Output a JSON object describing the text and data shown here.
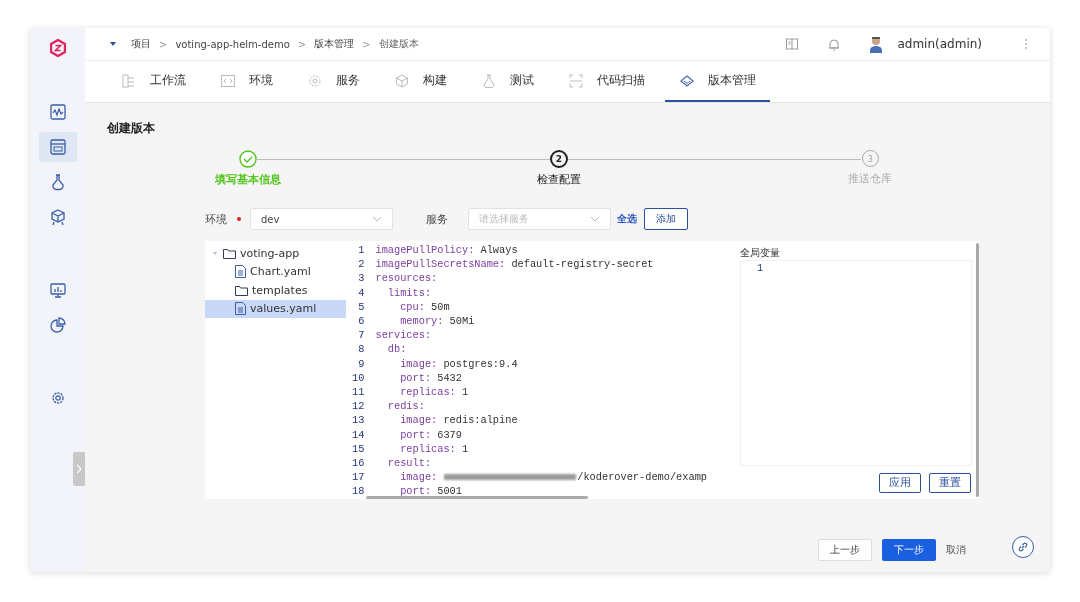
{
  "breadcrumb": [
    {
      "label": "项目"
    },
    {
      "separator": ">",
      "label": "voting-app-helm-demo"
    },
    {
      "separator": ">",
      "label": "版本管理"
    },
    {
      "separator": ">",
      "label": "创建版本"
    }
  ],
  "user": {
    "name": "admin(admin)"
  },
  "sidebar": {
    "items": [
      {
        "selected": false
      },
      {
        "selected": true
      },
      {
        "selected": false
      },
      {
        "selected": false
      },
      {
        "selected": false
      },
      {
        "selected": false
      },
      {
        "selected": false
      }
    ]
  },
  "tabs": [
    {
      "label": "工作流",
      "selected": false
    },
    {
      "label": "环境",
      "selected": false
    },
    {
      "label": "服务",
      "selected": false
    },
    {
      "label": "构建",
      "selected": false
    },
    {
      "label": "测试",
      "selected": false
    },
    {
      "label": "代码扫描",
      "selected": false
    },
    {
      "label": "版本管理",
      "selected": true
    }
  ],
  "page_title": "创建版本",
  "steps": [
    {
      "label": "填写基本信息",
      "kind": "done"
    },
    {
      "number": "2",
      "label": "检查配置",
      "kind": "current"
    },
    {
      "number": "3",
      "label": "推送仓库",
      "kind": "pending"
    }
  ],
  "form": {
    "env_label": "环境",
    "env_required": true,
    "env_value": "dev",
    "service_label": "服务",
    "service_placeholder": "请选择服务",
    "select_all": "全选",
    "add_button": "添加"
  },
  "file_tree": [
    {
      "name": "voting-app",
      "kind": "folder",
      "expanded": true,
      "selected": false,
      "children": [
        {
          "name": "Chart.yaml",
          "kind": "file",
          "selected": false
        },
        {
          "name": "templates",
          "kind": "folder",
          "selected": false
        },
        {
          "name": "values.yaml",
          "kind": "file",
          "selected": true
        }
      ]
    }
  ],
  "code_lines": [
    {
      "n": "1",
      "text": "imagePullPolicy: Always"
    },
    {
      "n": "2",
      "text": "imagePullSecretsName: default-registry-secret"
    },
    {
      "n": "3",
      "text": "resources:"
    },
    {
      "n": "4",
      "text": "  limits:"
    },
    {
      "n": "5",
      "text": "    cpu: 50m"
    },
    {
      "n": "6",
      "text": "    memory: 50Mi"
    },
    {
      "n": "7",
      "text": "services:"
    },
    {
      "n": "8",
      "text": "  db:"
    },
    {
      "n": "9",
      "text": "    image: postgres:9.4"
    },
    {
      "n": "10",
      "text": "    port: 5432"
    },
    {
      "n": "11",
      "text": "    replicas: 1"
    },
    {
      "n": "12",
      "text": "  redis:"
    },
    {
      "n": "13",
      "text": "    image: redis:alpine"
    },
    {
      "n": "14",
      "text": "    port: 6379"
    },
    {
      "n": "15",
      "text": "    replicas: 1"
    },
    {
      "n": "16",
      "text": "  result:"
    },
    {
      "n": "17",
      "text": "    image:",
      "redacted": true,
      "text_after": "/koderover-demo/examp"
    },
    {
      "n": "18",
      "text": "    port: 5001"
    }
  ],
  "global_vars": {
    "title": "全局变量",
    "lines": [
      "1"
    ],
    "apply_button": "应用",
    "reset_button": "重置"
  },
  "footer": {
    "prev_button": "上一步",
    "next_button": "下一步",
    "cancel_button": "取消"
  }
}
